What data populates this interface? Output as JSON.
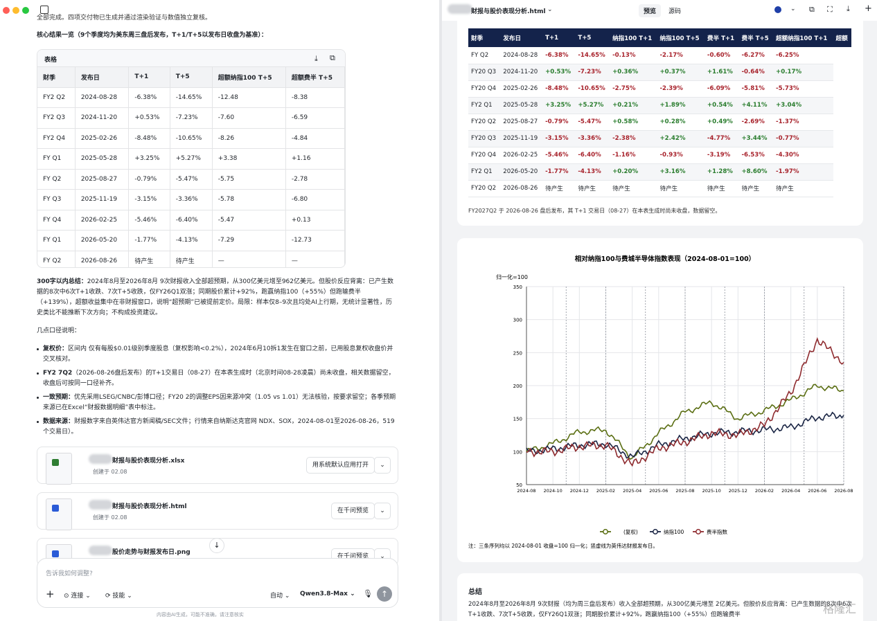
{
  "left": {
    "intro": "全部完成。四项交付物已生成并通过渲染验证与数值独立复核。",
    "section_title": "核心结果一览（9个季度均为美东周三盘后发布，T+1/T+5以发布日收盘为基准）：",
    "table": {
      "label": "表格",
      "headers": [
        "财季",
        "发布日",
        "T+1",
        "T+5",
        "超额纳指100 T+5",
        "超额费半 T+5"
      ],
      "rows": [
        [
          "FY2  Q2",
          "2024-08-28",
          "-6.38%",
          "-14.65%",
          "-12.48",
          "-8.38"
        ],
        [
          "FY2  Q3",
          "2024-11-20",
          "+0.53%",
          "-7.23%",
          "-7.60",
          "-6.59"
        ],
        [
          "FY2  Q4",
          "2025-02-26",
          "-8.48%",
          "-10.65%",
          "-8.26",
          "-4.84"
        ],
        [
          "FY  Q1",
          "2025-05-28",
          "+3.25%",
          "+5.27%",
          "+3.38",
          "+1.16"
        ],
        [
          "FY  Q2",
          "2025-08-27",
          "-0.79%",
          "-5.47%",
          "-5.75",
          "-2.78"
        ],
        [
          "FY  Q3",
          "2025-11-19",
          "-3.15%",
          "-3.36%",
          "-5.78",
          "-6.80"
        ],
        [
          "FY  Q4",
          "2026-02-25",
          "-5.46%",
          "-6.40%",
          "-5.47",
          "+0.13"
        ],
        [
          "FY  Q1",
          "2026-05-20",
          "-1.77%",
          "-4.13%",
          "-7.29",
          "-12.73"
        ],
        [
          "FY  Q2",
          "2026-08-26",
          "待产生",
          "待产生",
          "—",
          "—"
        ]
      ]
    },
    "summary_label": "300字以内总结：",
    "summary_text": "2024年8月至2026年8月    9次财报收入全部超预期，从300亿美元增至962亿美元。但股价反应背离：已产生数据的8次中6次T+1收跌、7次T+5收跌，仅FY26Q1双涨；同期股价累计+92%，跑赢纳指100（+55%）但跑输费半（+139%），超额收益集中在非财报窗口，说明“超预期”已被提前定价。局限：样本仅8–9次且均处AI上行期，无统计显著性，历史类比不能推断下次方向；不构成投资建议。",
    "caliber_title": "几点口径说明：",
    "bullets": [
      {
        "label": "复权价：",
        "text": "区间内     仅有每股$0.01级别季度股息（复权影响<0.2%），2024年6月10拆1发生在窗口之前，已用股息复权收盘价并交叉核对。"
      },
      {
        "label": "FY2   7Q2",
        "text": "（2026-08-26盘后发布）的T+1交易日（08-27）在本表生成时（北京时间08-28凌晨）尚未收盘，相关数据留空，收盘后可按同一口径补齐。"
      },
      {
        "label": "一致预期：",
        "text": "优先采用LSEG/CNBC/彭博口径；FY20   2的调整EPS因来源冲突（1.05 vs 1.01）无法核验，按要求留空；各季预期来源已在Excel“财报数据明细”表中标注。"
      },
      {
        "label": "数据来源：",
        "text": "财报数字来自英伟达官方新闻稿/SEC文件；行情来自纳斯达克官网        NDX、SOX，2024-08-01至2026-08-26，519个交易日）。"
      }
    ],
    "files": [
      {
        "name": "财报与股价表现分析.xlsx",
        "date": "创建于 02.08",
        "action": "用系统默认应用打开"
      },
      {
        "name": "财报与股价表现分析.html",
        "date": "创建于 02.08",
        "action": "在千问预览"
      },
      {
        "name": "股价走势与财报发布日.png",
        "date": "",
        "action": "在千问预览"
      }
    ],
    "composer": {
      "placeholder": "告诉我如何调整?",
      "connect": "连接",
      "skills": "技能",
      "mode": "自动",
      "model": "Qwen3.8-Max"
    },
    "footer": "内容由AI生成，可能不准确，请注意核实"
  },
  "right": {
    "tab_title": "财报与股价表现分析.html",
    "tabs": [
      "预览",
      "源码"
    ],
    "table": {
      "headers": [
        "财季",
        "发布日",
        "T+1",
        "T+5",
        "纳指100 T+1",
        "纳指100 T+5",
        "费半 T+1",
        "费半 T+5",
        "超额纳指100 T+1",
        "超额"
      ],
      "rows": [
        [
          "FY  Q2",
          "2024-08-28",
          "-6.38%",
          "-14.65%",
          "-0.13%",
          "-2.17%",
          "-0.60%",
          "-6.27%",
          "-6.25%"
        ],
        [
          "FY20  Q3",
          "2024-11-20",
          "+0.53%",
          "-7.23%",
          "+0.36%",
          "+0.37%",
          "+1.61%",
          "-0.64%",
          "+0.17%"
        ],
        [
          "FY20  Q4",
          "2025-02-26",
          "-8.48%",
          "-10.65%",
          "-2.75%",
          "-2.39%",
          "-6.09%",
          "-5.81%",
          "-5.73%"
        ],
        [
          "FY2  Q1",
          "2025-05-28",
          "+3.25%",
          "+5.27%",
          "+0.21%",
          "+1.89%",
          "+0.54%",
          "+4.11%",
          "+3.04%"
        ],
        [
          "FY20  Q2",
          "2025-08-27",
          "-0.79%",
          "-5.47%",
          "+0.58%",
          "+0.28%",
          "+0.49%",
          "-2.69%",
          "-1.37%"
        ],
        [
          "FY20  Q3",
          "2025-11-19",
          "-3.15%",
          "-3.36%",
          "-2.38%",
          "+2.42%",
          "-4.77%",
          "+3.44%",
          "-0.77%"
        ],
        [
          "FY20  Q4",
          "2026-02-25",
          "-5.46%",
          "-6.40%",
          "-1.16%",
          "-0.93%",
          "-3.19%",
          "-6.53%",
          "-4.30%"
        ],
        [
          "FY2  Q1",
          "2026-05-20",
          "-1.77%",
          "-4.13%",
          "+0.20%",
          "+3.16%",
          "+1.28%",
          "+8.60%",
          "-1.97%"
        ],
        [
          "FY20  Q2",
          "2026-08-26",
          "待产生",
          "待产生",
          "待产生",
          "待产生",
          "待产生",
          "待产生",
          "待产生"
        ]
      ],
      "note": "FY2027Q2 于 2026-08-26 盘后发布，其 T+1 交易日（08-27）在本表生成时尚未收盘，数据留空。"
    },
    "summary_title": "总结",
    "summary_text": "2024年8月至2026年8月    9次财报（均为周三盘后发布）收入全部超预期，从300亿美元增至    2亿美元。但股价反应背离：已产生数据的8次中6次T+1收跌、7次T+5收跌，仅FY26Q1双涨；同期股价累计+92%，跑赢纳指100（+55%）但跑输费半",
    "watermark": "格隆汇"
  },
  "chart_data": {
    "type": "line",
    "title": "相对纳指100与费城半导体指数表现（2024-08-01=100）",
    "ylabel": "归一化=100",
    "ylim": [
      50,
      350
    ],
    "yticks": [
      50,
      100,
      150,
      200,
      250,
      300,
      350
    ],
    "x": [
      "2024-08",
      "2024-10",
      "2024-12",
      "2025-02",
      "2025-04",
      "2025-06",
      "2025-08",
      "2025-10",
      "2025-12",
      "2026-02",
      "2026-04",
      "2026-06",
      "2026-08"
    ],
    "series": [
      {
        "name": "(复权)",
        "color": "#5a6e12",
        "values": [
          100,
          112,
          130,
          133,
          90,
          128,
          160,
          175,
          150,
          162,
          178,
          200,
          192
        ]
      },
      {
        "name": "纳指100",
        "color": "#1a2544",
        "values": [
          100,
          104,
          110,
          112,
          92,
          110,
          120,
          128,
          130,
          133,
          137,
          152,
          155
        ]
      },
      {
        "name": "费半指数",
        "color": "#8e2a2e",
        "values": [
          100,
          100,
          108,
          110,
          80,
          105,
          115,
          128,
          125,
          140,
          190,
          270,
          235
        ]
      }
    ],
    "earnings_dates": [
      "2024-08",
      "2024-11",
      "2025-02",
      "2025-05",
      "2025-08",
      "2025-11",
      "2026-02",
      "2026-05",
      "2026-08"
    ],
    "note": "注：三条序列均以 2024-08-01 收盘=100 归一化；竖虚线为英伟达财报发布日。"
  }
}
